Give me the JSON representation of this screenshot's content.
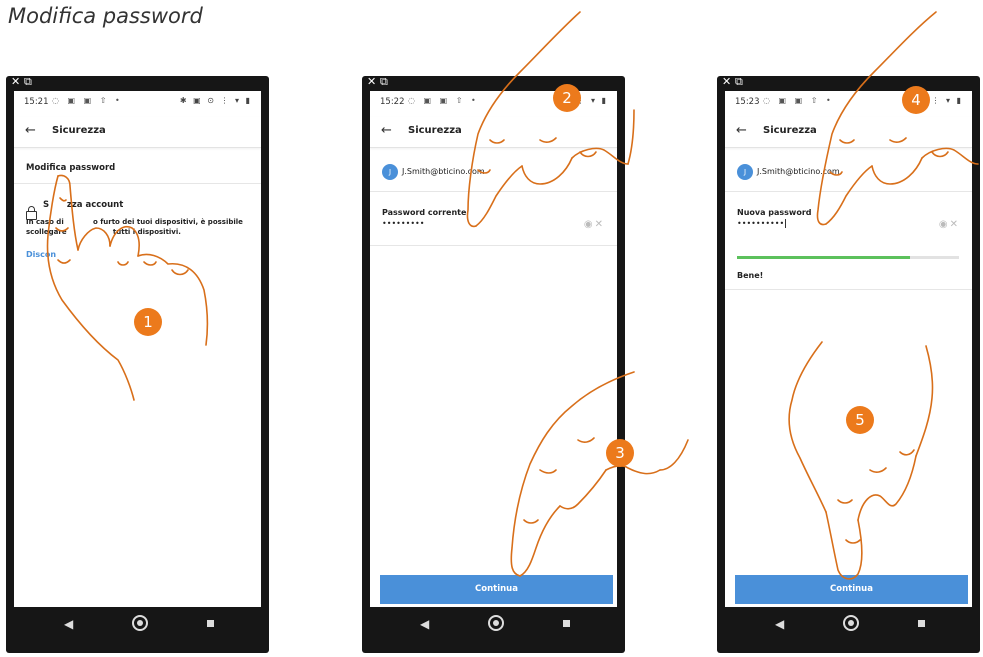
{
  "heading": "Modifica password",
  "colors": {
    "accent": "#4a90d9",
    "badge": "#ec7a1c",
    "strength": "#5cc15c"
  },
  "phones": [
    {
      "time": "15:21",
      "title": "Sicurezza",
      "modifica_label": "Modifica password",
      "account_title": "Scollega account",
      "account_title_visible": "S      zza account",
      "account_desc_1": "In caso di            o furto dei tuoi dispositivi, è possibile",
      "account_desc_2": "scollegare                   tutti i dispositivi.",
      "disconnect_link": "Discon",
      "step": "1"
    },
    {
      "time": "15:22",
      "title": "Sicurezza",
      "avatar_initial": "J",
      "email": "J.Smith@bticino.com",
      "field_label": "Password corrente",
      "field_value": "•••••••••",
      "continue_label": "Continua",
      "steps": [
        "2",
        "3"
      ]
    },
    {
      "time": "15:23",
      "title": "Sicurezza",
      "avatar_initial": "J",
      "email": "J.Smith@bticino.com",
      "field_label": "Nuova password",
      "field_value": "••••••••••",
      "strength_fraction": 0.78,
      "strength_label": "Bene!",
      "continue_label": "Continua",
      "steps": [
        "4",
        "5"
      ]
    }
  ],
  "icons": {
    "window_controls": "close-icon, external-icon",
    "visibility": "eye-icon",
    "clear": "close-icon",
    "nav": [
      "back-triangle-icon",
      "home-circle-icon",
      "recents-square-icon"
    ]
  }
}
